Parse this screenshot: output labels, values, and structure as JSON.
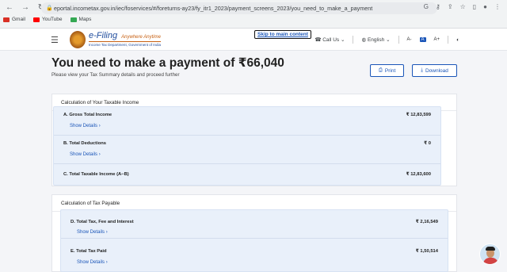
{
  "browser": {
    "url": "eportal.incometax.gov.in/iec/foservices/#/foreturns-ay23/fy_itr1_2023/payment_screens_2023/you_need_to_make_a_payment",
    "bookmarks": [
      {
        "label": "Gmail",
        "color": "#d93025"
      },
      {
        "label": "YouTube",
        "color": "#ff0000"
      },
      {
        "label": "Maps",
        "color": "#34a853"
      }
    ]
  },
  "header": {
    "logo_main": "e-Filing",
    "logo_hindi": "Anywhere Anytime",
    "logo_sub": "Income Tax Department, Government of India",
    "skip_link": "Skip to main content",
    "call_us": "Call Us",
    "language": "English",
    "font_small": "A-",
    "font_normal": "A",
    "font_large": "A+"
  },
  "page": {
    "title": "You need to make a payment of ₹66,040",
    "subtitle": "Please view your Tax Summary details and proceed further",
    "print": "Print",
    "download": "Download"
  },
  "taxable_income": {
    "title": "Calculation of Your Taxable Income",
    "rows": [
      {
        "label": "A. Gross Total Income",
        "value": "₹ 12,83,599",
        "link": "Show Details"
      },
      {
        "label": "B. Total Deductions",
        "value": "₹ 0",
        "link": "Show Details"
      },
      {
        "label": "C. Total Taxable Income (A−B)",
        "value": "₹ 12,83,600",
        "link": ""
      }
    ]
  },
  "tax_payable": {
    "title": "Calculation of Tax Payable",
    "rows": [
      {
        "label": "D. Total Tax, Fee and Interest",
        "value": "₹ 2,16,549",
        "link": "Show Details"
      },
      {
        "label": "E. Total Tax Paid",
        "value": "₹ 1,50,514",
        "link": "Show Details"
      }
    ]
  },
  "colors": {
    "accent": "#1a55b8",
    "section_bg": "#e9f0fa"
  }
}
